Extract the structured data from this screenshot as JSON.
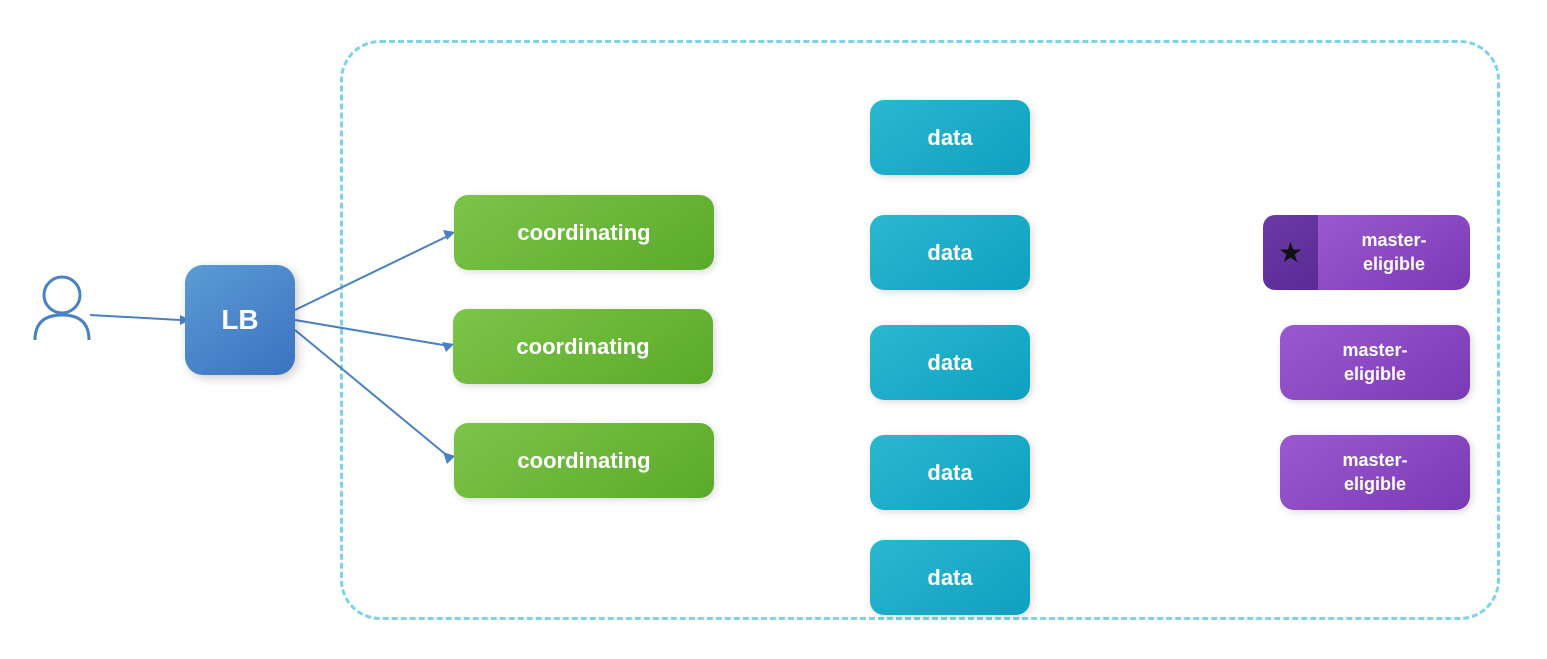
{
  "lb": {
    "label": "LB"
  },
  "coordinating": {
    "label1": "coordinating",
    "label2": "coordinating",
    "label3": "coordinating"
  },
  "data": {
    "label1": "data",
    "label2": "data",
    "label3": "data",
    "label4": "data",
    "label5": "data"
  },
  "master": {
    "label1": "master-\neligible",
    "label2": "master-\neligible",
    "label3": "master-\neligible",
    "text1": "master-eligible",
    "text2": "master-eligible",
    "text3": "master-eligible"
  },
  "colors": {
    "dashed_border": "#7dd3e8",
    "lb_bg": "#4a80c4",
    "coord_bg": "#6cbb35",
    "data_bg": "#1ab0c8",
    "master_bg": "#8b45c8",
    "arrow_color": "#3a6db5"
  }
}
